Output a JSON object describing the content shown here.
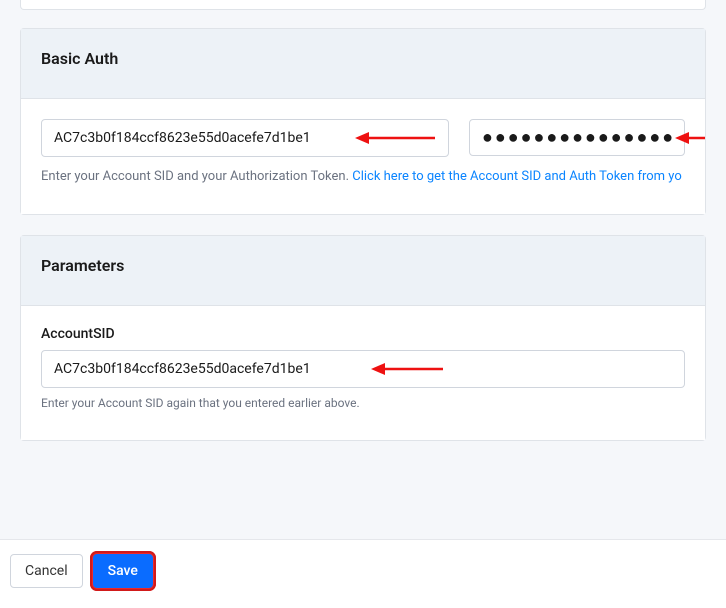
{
  "basicAuth": {
    "title": "Basic Auth",
    "accountSidValue": "AC7c3b0f184ccf8623e55d0acefe7d1be1",
    "tokenMask": "●●●●●●●●●●●●●●●●●●●●●●●●●●●●●●●●",
    "helperPrefix": "Enter your Account SID and your Authorization Token. ",
    "helperLink": "Click here to get the Account SID and Auth Token from yo"
  },
  "parameters": {
    "title": "Parameters",
    "accountSidLabel": "AccountSID",
    "accountSidValue": "AC7c3b0f184ccf8623e55d0acefe7d1be1",
    "helper": "Enter your Account SID again that you entered earlier above."
  },
  "footer": {
    "cancel": "Cancel",
    "save": "Save"
  },
  "colors": {
    "accent": "#0a6cff",
    "link": "#0a84ff",
    "annotation": "#e11"
  }
}
